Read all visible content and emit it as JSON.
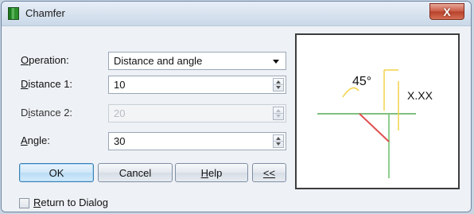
{
  "window": {
    "title": "Chamfer",
    "close_label": "X"
  },
  "form": {
    "operation": {
      "label_u": "O",
      "label_rest": "peration:",
      "value": "Distance and angle"
    },
    "distance1": {
      "label_u": "D",
      "label_rest": "istance 1:",
      "value": "10"
    },
    "distance2": {
      "label_pre": "D",
      "label_u": "i",
      "label_rest": "stance 2:",
      "value": "20",
      "disabled": true
    },
    "angle": {
      "label_u": "A",
      "label_rest": "ngle:",
      "value": "30"
    }
  },
  "buttons": {
    "ok": "OK",
    "cancel": "Cancel",
    "help_u": "H",
    "help_rest": "elp",
    "collapse": "<<"
  },
  "checkbox": {
    "label_u": "R",
    "label_rest": "eturn to Dialog",
    "checked": false
  },
  "preview": {
    "angle_label": "45°",
    "distance_label": "X.XX",
    "colors": {
      "horizontal": "#7fbf7f",
      "vertical": "#8fd08f",
      "chamfer": "#e05050",
      "dimension": "#f2d24a"
    }
  }
}
